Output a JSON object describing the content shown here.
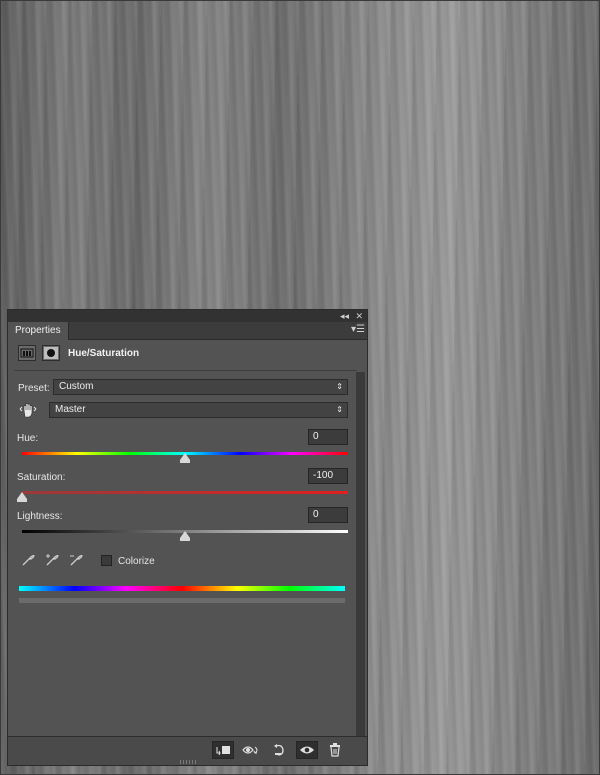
{
  "panel": {
    "tab_label": "Properties",
    "collapse_glyph": "◂◂",
    "close_glyph": "✕",
    "menu_glyph": "▾☰",
    "title": "Hue/Saturation",
    "preset": {
      "label": "Preset:",
      "value": "Custom"
    },
    "channel": {
      "value": "Master"
    },
    "hue": {
      "label": "Hue:",
      "value": "0",
      "level": 0.5
    },
    "saturation": {
      "label": "Saturation:",
      "value": "-100",
      "level": 0.0
    },
    "lightness": {
      "label": "Lightness:",
      "value": "0",
      "level": 0.5
    },
    "colorize": {
      "label": "Colorize",
      "checked": false
    },
    "icons": {
      "adjustment": "hue-saturation-icon",
      "mask": "layer-mask-icon",
      "targeted_adjustment": "hand-adjust-icon",
      "eyedroppers": [
        "eyedropper-icon",
        "eyedropper-add-icon",
        "eyedropper-subtract-icon"
      ],
      "footer": [
        "clip-to-layer-icon",
        "view-previous-state-icon",
        "reset-icon",
        "visibility-eye-icon",
        "delete-trash-icon"
      ]
    },
    "colors": {
      "panel_bg": "#535353",
      "accent_hue_spectrum": "#ff0000",
      "saturation_track": "#e02020"
    }
  }
}
